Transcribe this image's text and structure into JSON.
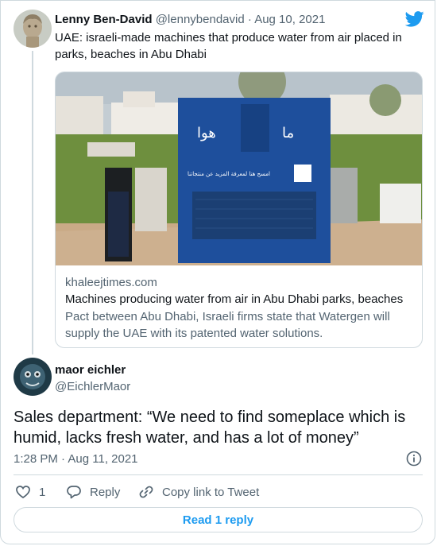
{
  "quoted_tweet": {
    "author_name": "Lenny Ben-David",
    "author_handle": "@lennybendavid",
    "separator": "·",
    "date": "Aug 10, 2021",
    "text": "UAE: israeli-made machines that produce water from air placed in parks, beaches in Abu Dhabi",
    "link_card": {
      "domain": "khaleejtimes.com",
      "title": "Machines producing water from air in Abu Dhabi parks, beaches",
      "description": "Pact between Abu Dhabi, Israeli firms state that Watergen will supply the UAE with its patented water solutions.",
      "image_text": {
        "brand_arabic": "هوا",
        "brand_latin": "ما",
        "panel_caption": "امسح هنا لمعرفة المزيد عن منتجاتنا"
      }
    }
  },
  "reply_tweet": {
    "author_name": "maor eichler",
    "author_handle": "@EichlerMaor",
    "text": "Sales department: “We need to find someplace which is humid, lacks fresh water, and has a lot of money”",
    "time": "1:28 PM",
    "separator": "·",
    "date": "Aug 11, 2021"
  },
  "actions": {
    "like_count": "1",
    "reply_label": "Reply",
    "copy_link_label": "Copy link to Tweet",
    "read_replies_label": "Read 1 reply"
  },
  "colors": {
    "twitter_blue": "#1d9bf0",
    "text_primary": "#0f1419",
    "text_secondary": "#536471",
    "border": "#cfd9de"
  },
  "icons": [
    "twitter-bird-icon",
    "info-icon",
    "heart-icon",
    "reply-icon",
    "link-icon"
  ]
}
